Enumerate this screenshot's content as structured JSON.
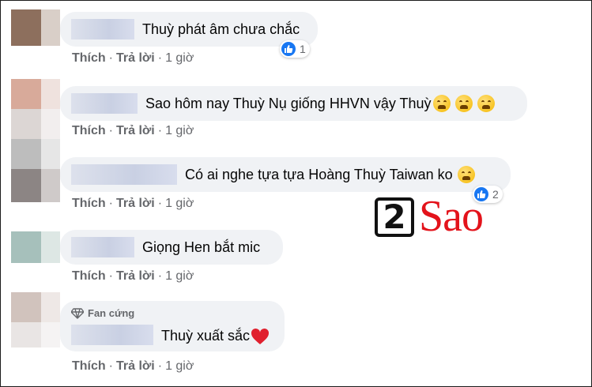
{
  "comments": [
    {
      "text": "Thuỳ phát âm chưa chắc",
      "like": "Thích",
      "reply": "Trả lời",
      "sep": "·",
      "time": "1 giờ",
      "reactions": "1"
    },
    {
      "text": "Sao hôm nay Thuỳ Nụ giống HHVN vậy Thuỳ",
      "like": "Thích",
      "reply": "Trả lời",
      "sep": "·",
      "time": "1 giờ",
      "emoji_count": 3
    },
    {
      "text": "Có ai nghe tựa tựa Hoàng Thuỳ Taiwan ko",
      "like": "Thích",
      "reply": "Trả lời",
      "sep": "·",
      "time": "1 giờ",
      "reactions": "2",
      "emoji_count": 1
    },
    {
      "text": "Giọng Hen bắt mic",
      "like": "Thích",
      "reply": "Trả lời",
      "sep": "·",
      "time": "1 giờ"
    },
    {
      "badge": "Fan cứng",
      "text": "Thuỳ xuất sắc",
      "like": "Thích",
      "reply": "Trả lời",
      "sep": "·",
      "time": "1 giờ"
    }
  ],
  "watermark": {
    "number": "2",
    "word": "Sao"
  },
  "colors": {
    "bubble": "#f0f2f5",
    "action_text": "#65676b",
    "like_blue": "#1877f2",
    "logo_red": "#e3131b"
  },
  "icons": [
    "like-icon",
    "weary-face-emoji",
    "red-heart-emoji",
    "diamond-icon"
  ]
}
